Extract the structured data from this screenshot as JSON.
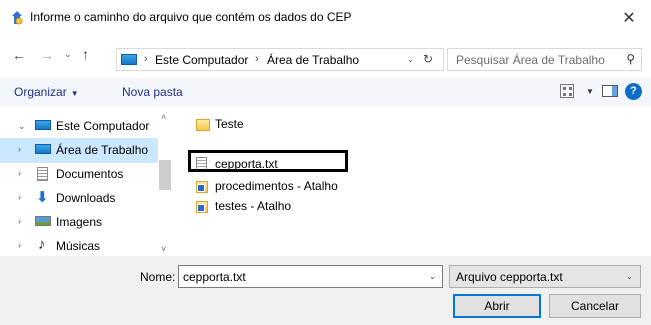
{
  "dialog": {
    "title": "Informe o caminho do arquivo que contém os dados do CEP",
    "close_glyph": "✕",
    "icon": "folder-search-icon"
  },
  "nav": {
    "back_glyph": "←",
    "forward_glyph": "→",
    "recent_glyph": "⌄",
    "up_glyph": "↑"
  },
  "address": {
    "segments": [
      "Este Computador",
      "Área de Trabalho"
    ],
    "separator": "›",
    "dropdown_glyph": "⌄",
    "refresh_glyph": "↻"
  },
  "search": {
    "placeholder": "Pesquisar Área de Trabalho",
    "icon_glyph": "⚲"
  },
  "toolbar": {
    "organize_label": "Organizar",
    "organize_caret": "▼",
    "new_folder_label": "Nova pasta",
    "views_caret": "▼",
    "help_label": "?"
  },
  "sidebar": {
    "items": [
      {
        "label": "Este Computador",
        "icon": "computer-icon",
        "expanded": true
      },
      {
        "label": "Área de Trabalho",
        "icon": "desktop-icon",
        "selected": true
      },
      {
        "label": "Documentos",
        "icon": "documents-icon"
      },
      {
        "label": "Downloads",
        "icon": "downloads-icon"
      },
      {
        "label": "Imagens",
        "icon": "pictures-icon"
      },
      {
        "label": "Músicas",
        "icon": "music-icon"
      }
    ],
    "expand_glyph": "›",
    "collapse_glyph": "⌄",
    "scroll_up_glyph": "˄",
    "scroll_down_glyph": "˅"
  },
  "files": [
    {
      "label": "Teste",
      "icon": "folder-icon"
    },
    {
      "label": "cepporta.txt",
      "icon": "text-file-icon",
      "highlighted": true
    },
    {
      "label": "procedimentos - Atalho",
      "icon": "shortcut-icon"
    },
    {
      "label": "testes - Atalho",
      "icon": "shortcut-icon"
    }
  ],
  "footer": {
    "name_label": "Nome:",
    "name_value": "cepporta.txt",
    "type_value": "Arquivo cepporta.txt",
    "dropdown_glyph": "⌄",
    "open_label": "Abrir",
    "cancel_label": "Cancelar"
  },
  "colors": {
    "accent": "#0078d7",
    "selection": "#cce8ff",
    "toolbar_bg": "#f3f6fa",
    "footer_bg": "#f0f0f0",
    "link_text": "#1e3287"
  }
}
